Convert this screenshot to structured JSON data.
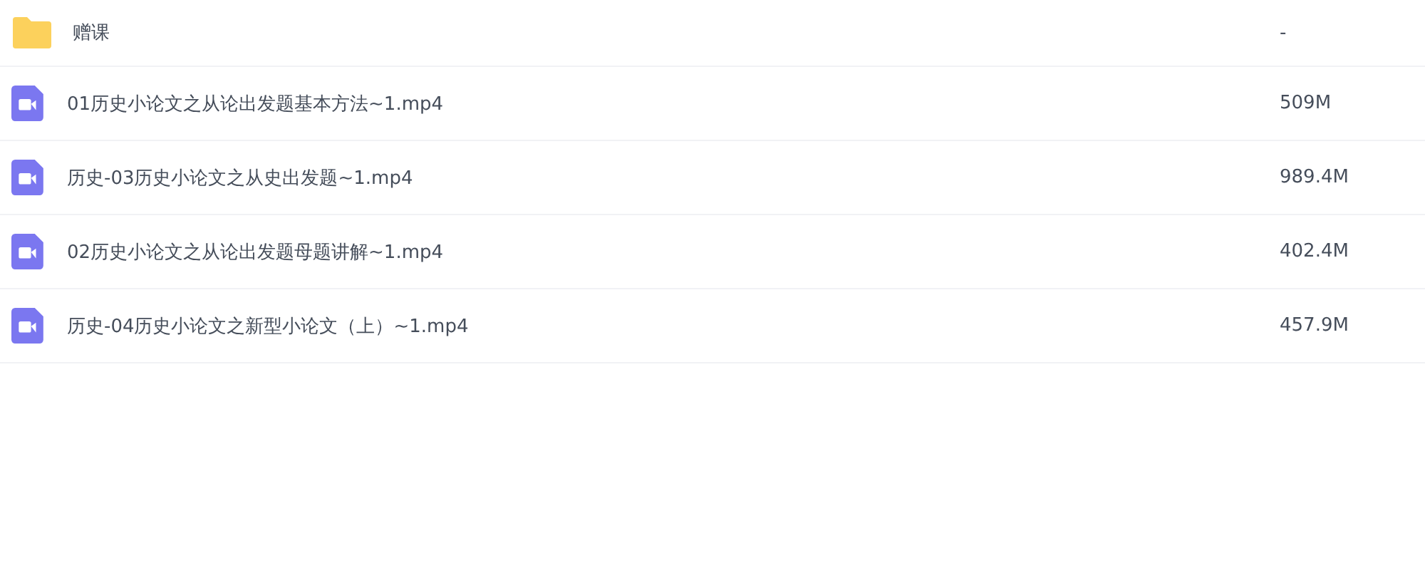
{
  "files": [
    {
      "kind": "folder",
      "name": "赠课",
      "size": "-"
    },
    {
      "kind": "video",
      "name": "01历史小论文之从论出发题基本方法~1.mp4",
      "size": "509M"
    },
    {
      "kind": "video",
      "name": "历史-03历史小论文之从史出发题~1.mp4",
      "size": "989.4M"
    },
    {
      "kind": "video",
      "name": "02历史小论文之从论出发题母题讲解~1.mp4",
      "size": "402.4M"
    },
    {
      "kind": "video",
      "name": "历史-04历史小论文之新型小论文（上）~1.mp4",
      "size": "457.9M"
    }
  ]
}
